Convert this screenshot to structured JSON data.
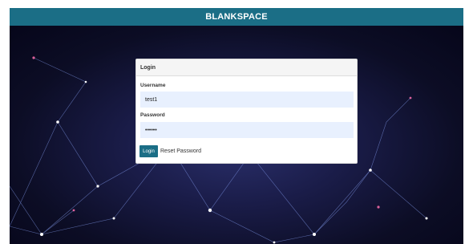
{
  "app": {
    "brand": "BLANKSPACE"
  },
  "login_panel": {
    "heading": "Login",
    "username": {
      "label": "Username",
      "value": "test1"
    },
    "password": {
      "label": "Password",
      "value": "••••••"
    },
    "login_button": "Login",
    "reset_link": "Reset Password"
  },
  "colors": {
    "accent": "#1b6e86",
    "field_bg": "#e8f0fe"
  }
}
